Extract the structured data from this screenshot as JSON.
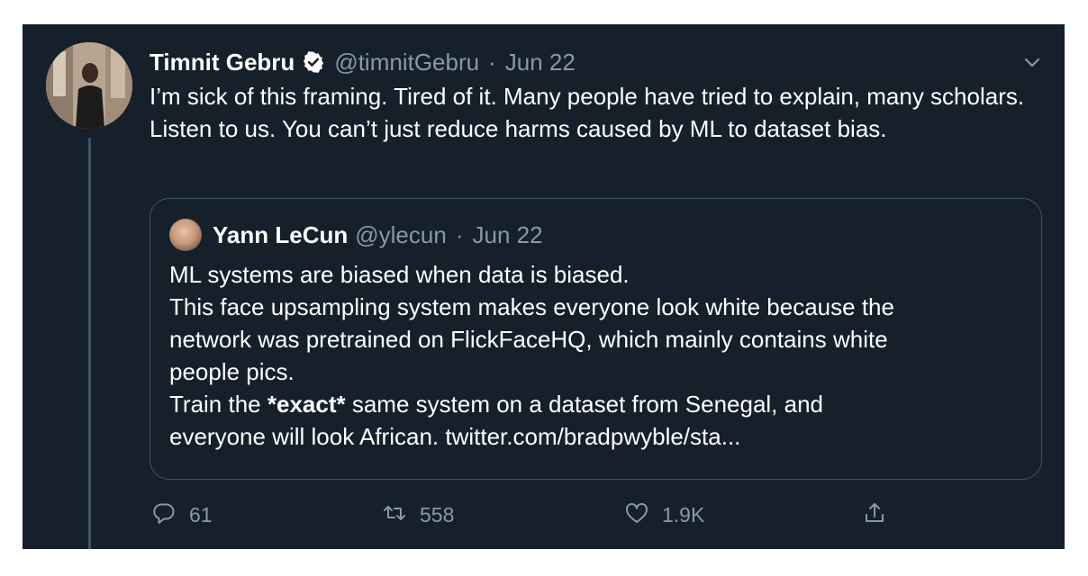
{
  "tweet": {
    "author_name": "Timnit Gebru",
    "author_handle": "@timnitGebru",
    "separator": "·",
    "date": "Jun 22",
    "text": "I’m sick of this framing. Tired of it. Many people have tried to explain, many scholars. Listen to us. You can’t just reduce harms caused by ML to dataset bias."
  },
  "quote": {
    "author_name": "Yann LeCun",
    "author_handle": "@ylecun",
    "separator": "·",
    "date": "Jun 22",
    "line1": "ML systems are biased when data is biased.",
    "line2": "This face upsampling system makes everyone look white because the",
    "line3": "network was pretrained on FlickFaceHQ, which mainly contains white",
    "line4": "people pics.",
    "line5_before": "Train the ",
    "line5_bold": "*exact*",
    "line5_after": " same system on a dataset from Senegal, and",
    "line6": "everyone will look African. twitter.com/bradpwyble/sta..."
  },
  "actions": {
    "reply_count": "61",
    "retweet_count": "558",
    "like_count": "1.9K"
  },
  "icons": {
    "verified": "verified-badge-icon",
    "more": "chevron-down-icon",
    "reply": "reply-icon",
    "retweet": "retweet-icon",
    "like": "heart-icon",
    "share": "share-icon"
  },
  "colors": {
    "background": "#15202b",
    "text_primary": "#ffffff",
    "text_secondary": "#8899a6",
    "border": "#3d5466"
  }
}
